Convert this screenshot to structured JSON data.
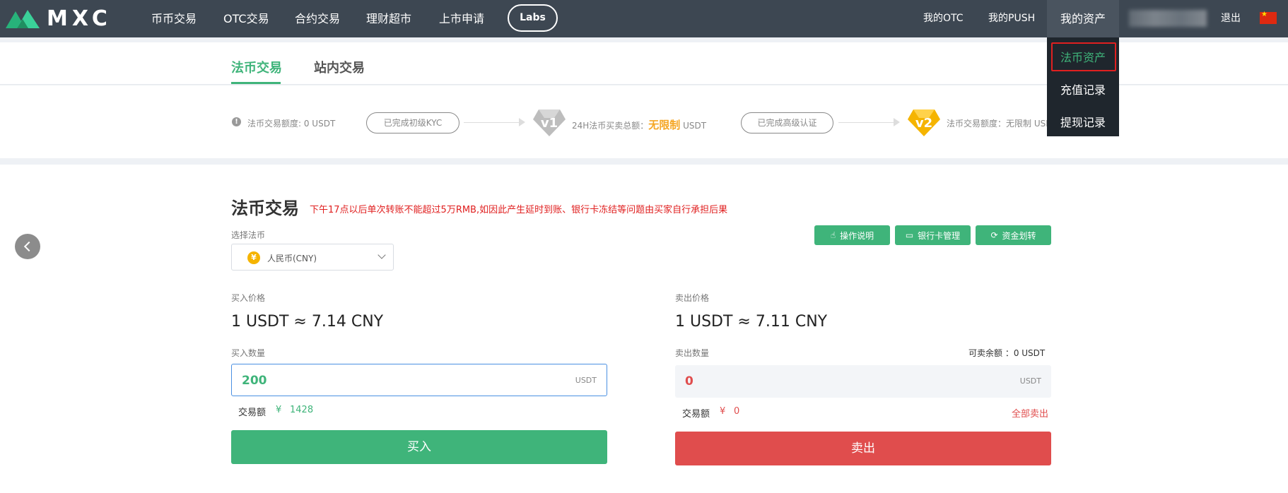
{
  "nav": {
    "logo_text": "MXC",
    "items": [
      "币币交易",
      "OTC交易",
      "合约交易",
      "理财超市",
      "上市申请"
    ],
    "labs": "Labs",
    "my_otc": "我的OTC",
    "my_push": "我的PUSH",
    "my_assets": "我的资产",
    "logout": "退出"
  },
  "dropdown": {
    "items": [
      "法币资产",
      "充值记录",
      "提现记录"
    ],
    "active_index": 0
  },
  "tabs": [
    "法币交易",
    "站内交易"
  ],
  "kyc": {
    "limit_text": "法币交易额度: 0 USDT",
    "level1_pill": "已完成初级KYC",
    "v1_badge": "v1",
    "v1_text_prefix": "24H法币买卖总额：",
    "v1_text_highlight": "无限制",
    "v1_text_suffix": "USDT",
    "level2_pill": "已完成高级认证",
    "v2_badge": "v2",
    "v2_text": "法币交易额度：无限制 USDT"
  },
  "main": {
    "title": "法币交易",
    "warning": "下午17点以后单次转账不能超过5万RMB,如因此产生延时到账、银行卡冻结等问题由买家自行承担后果",
    "select_label": "选择法币",
    "select_value": "人民币(CNY)",
    "currency_symbol": "¥",
    "buttons": [
      "操作说明",
      "银行卡管理",
      "资金划转"
    ]
  },
  "buy": {
    "price_label": "买入价格",
    "price": "1 USDT ≈ 7.14  CNY",
    "amount_label": "买入数量",
    "amount_value": "200",
    "unit": "USDT",
    "total_label": "交易额",
    "total_currency": "¥",
    "total_value": "1428",
    "button": "买入"
  },
  "sell": {
    "price_label": "卖出价格",
    "price": "1 USDT ≈ 7.11  CNY",
    "amount_label": "卖出数量",
    "available": "可卖余额 ：0 USDT",
    "amount_value": "0",
    "unit": "USDT",
    "total_label": "交易额",
    "total_currency": "¥",
    "total_value": "0",
    "sell_all": "全部卖出",
    "button": "卖出"
  },
  "colors": {
    "nav_bg": "#3d4752",
    "green": "#3fb47a",
    "red": "#e04d4d",
    "gold": "#f5a623"
  },
  "icons": [
    "mxc-logo-icon",
    "flag-cn-icon",
    "info-icon",
    "yuan-icon",
    "chevron-down-icon",
    "hand-icon",
    "card-icon",
    "transfer-icon",
    "chevron-left-icon"
  ]
}
